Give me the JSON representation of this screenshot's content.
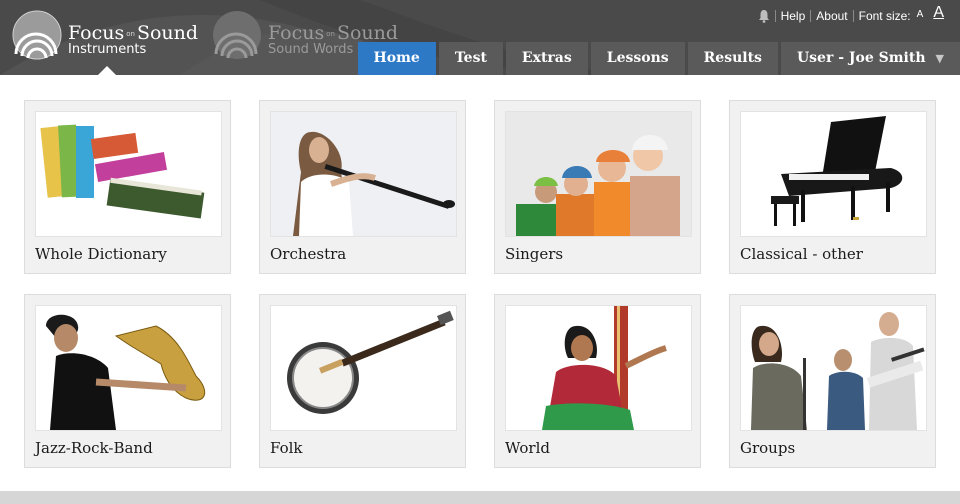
{
  "header": {
    "logo_primary": {
      "word1": "Focus",
      "on": "on",
      "word2": "Sound",
      "subtitle": "Instruments"
    },
    "logo_secondary": {
      "word1": "Focus",
      "on": "on",
      "word2": "Sound",
      "subtitle": "Sound Words"
    },
    "utility": {
      "help": "Help",
      "about": "About",
      "font_size_label": "Font size:",
      "font_small": "A",
      "font_large": "A"
    }
  },
  "nav": {
    "items": [
      {
        "label": "Home",
        "active": true
      },
      {
        "label": "Test"
      },
      {
        "label": "Extras"
      },
      {
        "label": "Lessons"
      },
      {
        "label": "Results"
      },
      {
        "label": "User - Joe Smith",
        "caret": "▼"
      }
    ]
  },
  "tiles": [
    {
      "label": "Whole Dictionary",
      "icon": "books-image"
    },
    {
      "label": "Orchestra",
      "icon": "oboe-player-image"
    },
    {
      "label": "Singers",
      "icon": "singers-image"
    },
    {
      "label": "Classical - other",
      "icon": "grand-piano-image"
    },
    {
      "label": "Jazz-Rock-Band",
      "icon": "saxophone-player-image"
    },
    {
      "label": "Folk",
      "icon": "banjo-image"
    },
    {
      "label": "World",
      "icon": "tanpura-player-image"
    },
    {
      "label": "Groups",
      "icon": "band-group-image"
    }
  ],
  "colors": {
    "header": "#4a4a4a",
    "nav_item": "#5a5a5a",
    "nav_active": "#2e79c6",
    "tile_bg": "#f1f1f1"
  }
}
